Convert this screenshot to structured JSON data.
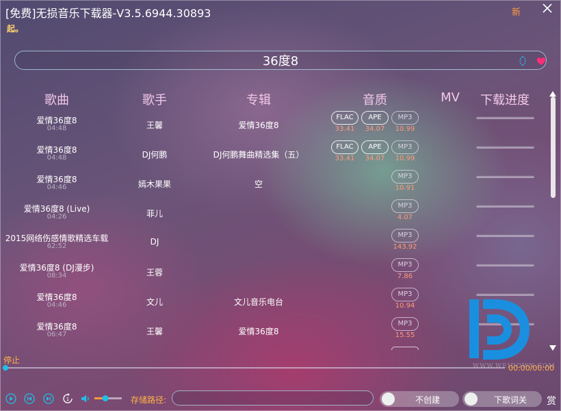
{
  "window": {
    "title": "[免费]无损音乐下载器-V3.5.6944.30893",
    "subtitle": "起。",
    "new_label": "新"
  },
  "search": {
    "value": "36度8"
  },
  "columns": {
    "song": "歌曲",
    "artist": "歌手",
    "album": "专辑",
    "quality": "音质",
    "mv": "MV",
    "progress": "下载进度"
  },
  "rows": [
    {
      "song": "爱情36度8",
      "duration": "04:48",
      "artist": "王馨",
      "album": "爱情36度8",
      "flac": "FLAC",
      "flac_size": "33.41",
      "ape": "APE",
      "ape_size": "34.07",
      "mp3": "MP3",
      "mp3_size": "10.99"
    },
    {
      "song": "爱情36度8",
      "duration": "04:48",
      "artist": "DJ何鹏",
      "album": "DJ何鹏舞曲精选集（五）",
      "flac": "FLAC",
      "flac_size": "33.41",
      "ape": "APE",
      "ape_size": "34.07",
      "mp3": "MP3",
      "mp3_size": "10.99"
    },
    {
      "song": "爱情36度8",
      "duration": "04:46",
      "artist": "嫣木果果",
      "album": "空",
      "mp3": "MP3",
      "mp3_size": "10.91"
    },
    {
      "song": "爱情36度8 (Live)",
      "duration": "04:26",
      "artist": "菲儿",
      "album": "",
      "mp3": "MP3",
      "mp3_size": "4.07"
    },
    {
      "song": "2015网络伤感情歌精选车载",
      "duration": "62:52",
      "artist": "DJ",
      "album": "",
      "mp3": "MP3",
      "mp3_size": "143.92"
    },
    {
      "song": "爱情36度8 (DJ漫步)",
      "duration": "08:34",
      "artist": "王蓉",
      "album": "",
      "mp3": "MP3",
      "mp3_size": "7.86"
    },
    {
      "song": "爱情36度8",
      "duration": "04:46",
      "artist": "文儿",
      "album": "文儿音乐电台",
      "mp3": "MP3",
      "mp3_size": "10.94"
    },
    {
      "song": "爱情36度8",
      "duration": "06:47",
      "artist": "王馨",
      "album": "爱情36度8",
      "mp3": "MP3",
      "mp3_size": "15.55"
    }
  ],
  "player": {
    "status": "停止",
    "time": "00:00/00:00",
    "seek_progress": 0,
    "volume": 0.4
  },
  "bottom": {
    "path_label": "存储路径:",
    "path_value": "",
    "toggle_folder": "不创建",
    "toggle_lyrics": "下歌词关",
    "reward": "赏"
  },
  "watermark": "WWW.WEIDOWN.COM",
  "colors": {
    "header_text": "#f3c8e8",
    "accent_orange": "#ffb347",
    "size_text": "#ff9a7a",
    "accent_cyan": "#1ec0e8",
    "logo_blue": "#1a8fe0"
  },
  "icons": [
    "close-icon",
    "search-icon",
    "heart-icon",
    "play-icon",
    "prev-icon",
    "next-icon",
    "loop-one-icon",
    "volume-icon",
    "scroll-up-icon",
    "scroll-down-icon",
    "logo-icon"
  ]
}
